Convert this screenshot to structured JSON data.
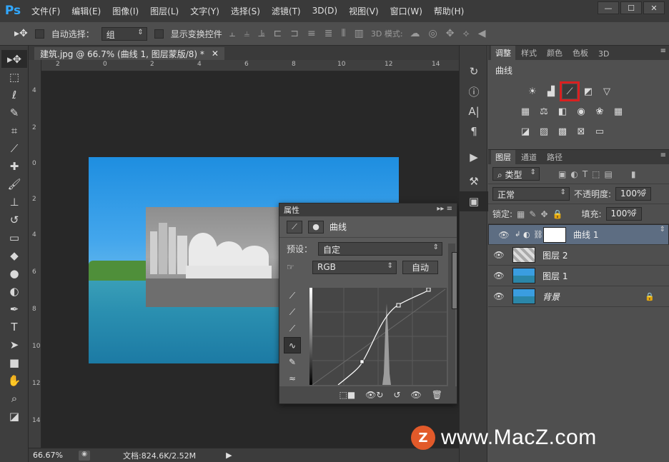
{
  "app": {
    "logo": "Ps"
  },
  "menu": [
    "文件(F)",
    "编辑(E)",
    "图像(I)",
    "图层(L)",
    "文字(Y)",
    "选择(S)",
    "滤镜(T)",
    "3D(D)",
    "视图(V)",
    "窗口(W)",
    "帮助(H)"
  ],
  "options": {
    "auto_select_label": "自动选择：",
    "auto_select_value": "组",
    "show_transform_label": "显示变换控件",
    "mode3d_label": "3D 模式:"
  },
  "document": {
    "tab_title": "建筑.jpg @ 66.7% (曲线 1, 图层蒙版/8) *",
    "zoom": "66.67%",
    "doc_info": "文档:824.6K/2.52M",
    "ruler_h": [
      "2",
      "0",
      "2",
      "4",
      "6",
      "8",
      "10",
      "12",
      "14"
    ],
    "ruler_v": [
      "4",
      "2",
      "0",
      "2",
      "4",
      "6",
      "8",
      "10",
      "12",
      "14"
    ]
  },
  "properties": {
    "panel_tab": "属性",
    "title": "曲线",
    "preset_label": "预设：",
    "preset_value": "自定",
    "channel_value": "RGB",
    "auto_label": "自动"
  },
  "adjustments": {
    "tabs": [
      "调整",
      "样式",
      "颜色",
      "色板",
      "3D"
    ],
    "title": "曲线",
    "highlight_color": "#d92020"
  },
  "layers_panel": {
    "tabs": [
      "图层",
      "通道",
      "路径"
    ],
    "filter_kind": "类型",
    "blend_mode": "正常",
    "opacity_label": "不透明度:",
    "opacity_value": "100%",
    "lock_label": "锁定:",
    "fill_label": "填充:",
    "fill_value": "100%",
    "layers": [
      {
        "name": "曲线 1",
        "selected": true
      },
      {
        "name": "图层 2",
        "selected": false
      },
      {
        "name": "图层 1",
        "selected": false
      },
      {
        "name": "背景",
        "selected": false
      }
    ]
  },
  "watermark": {
    "logo": "Z",
    "text": "www.MacZ.com"
  }
}
